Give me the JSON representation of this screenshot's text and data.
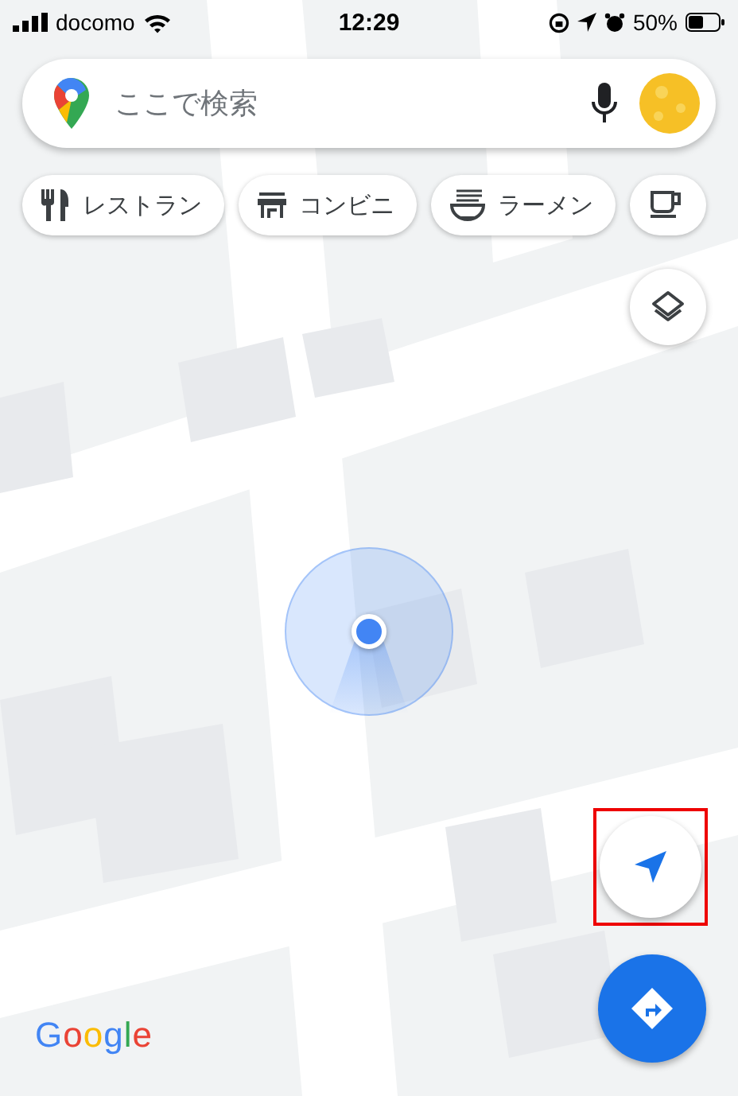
{
  "status_bar": {
    "carrier": "docomo",
    "time": "12:29",
    "battery": "50%"
  },
  "search": {
    "placeholder": "ここで検索"
  },
  "chips": [
    {
      "kind": "restaurant",
      "label": "レストラン"
    },
    {
      "kind": "store",
      "label": "コンビニ"
    },
    {
      "kind": "ramen",
      "label": "ラーメン"
    },
    {
      "kind": "cafe"
    }
  ],
  "logo": "Google"
}
